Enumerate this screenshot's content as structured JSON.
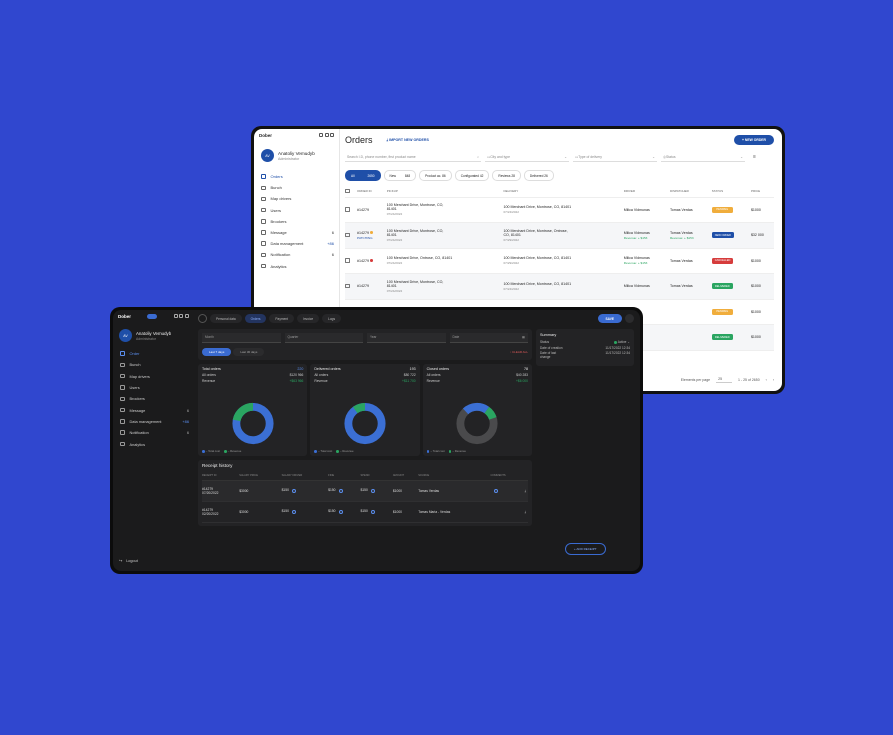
{
  "light": {
    "brand": "Dober",
    "user": {
      "initials": "AV",
      "name": "Anatoliy Vemudyb",
      "role": "Administrator"
    },
    "nav": [
      {
        "label": "Orders",
        "count": ""
      },
      {
        "label": "Bunch",
        "count": ""
      },
      {
        "label": "Map drivers",
        "count": ""
      },
      {
        "label": "Users",
        "count": ""
      },
      {
        "label": "Brookers",
        "count": ""
      },
      {
        "label": "Message",
        "count": "6"
      },
      {
        "label": "Data management",
        "count": "+86"
      },
      {
        "label": "Notification",
        "count": "6"
      },
      {
        "label": "Analytics",
        "count": ""
      }
    ],
    "title": "Orders",
    "import_label": "IMPORT NEW ORDERS",
    "new_order_label": "+ NEW ORDER",
    "search_placeholder": "Search I.D, phone number, first product name",
    "filter_city": "City and type",
    "filter_delivery": "Type of delivery",
    "filter_status": "Status",
    "tabs": [
      {
        "label": "All",
        "count": "2650"
      },
      {
        "label": "New",
        "count": "848"
      },
      {
        "label": "Product ac.",
        "count": "86"
      },
      {
        "label": "Configurated",
        "count": "42"
      },
      {
        "label": "Reviews",
        "count": "28"
      },
      {
        "label": "Delivered",
        "count": "26"
      }
    ],
    "columns": [
      "ORDER ID",
      "PICKUP",
      "DELIVERY",
      "DRIVER",
      "DISPATCHER",
      "STATUS",
      "PRICE"
    ],
    "rows": [
      {
        "id": "#14279",
        "flag": "",
        "flag_color": "",
        "pickup": "100 Merchant Drive, Montrose, CO, 81401",
        "pickup_date": "07/24/2022",
        "delivery": "100 Merchant Drive, Montrose, CO, 81401",
        "delivery_date": "07/24/2022",
        "driver": "Milica Vidmunas",
        "driver_sub": "",
        "dispatcher": "Tomas Verdas",
        "dispatcher_sub": "",
        "status": "PENDING",
        "status_color": "#f0ad3c",
        "price": "$1000"
      },
      {
        "id": "#14279",
        "flag": "PATCHING",
        "flag_color": "#f0ad3c",
        "pickup": "100 Merchant Drive, Montrose, CO, 81401",
        "pickup_date": "07/24/2022",
        "delivery": "100 Merchant Drive, Montrose, Ontrose, CO, 81401",
        "delivery_date": "07/29/2022",
        "driver": "Milica Vidmunas",
        "driver_sub": "Revenue: + $153",
        "dispatcher": "Tomas Verdas",
        "dispatcher_sub": "Revenue: + $153",
        "status": "NEW ORDER",
        "status_color": "#1f4fa8",
        "price": "$32 000"
      },
      {
        "id": "#14279",
        "flag": "",
        "flag_color": "#d63c3c",
        "pickup": "100 Merchant Drive, Ontrose, CO, 81401",
        "pickup_date": "07/24/2022",
        "delivery": "100 Merchant Drive, Montrose, CO, 81401",
        "delivery_date": "07/29/2022",
        "driver": "Milica Vidmunas",
        "driver_sub": "Revenue: + $153",
        "dispatcher": "Tomas Verdas",
        "dispatcher_sub": "",
        "status": "CANCELLED",
        "status_color": "#d63c3c",
        "price": "$1000"
      },
      {
        "id": "#14279",
        "flag": "",
        "flag_color": "",
        "pickup": "100 Merchant Drive, Montrose, CO, 81401",
        "pickup_date": "07/24/2022",
        "delivery": "100 Merchant Drive, Montrose, CO, 81401",
        "delivery_date": "07/24/2022",
        "driver": "Milica Vidmunas",
        "driver_sub": "",
        "dispatcher": "Tomas Verdas",
        "dispatcher_sub": "",
        "status": "DELIVERED",
        "status_color": "#2aa561",
        "price": "$1000"
      }
    ],
    "extra_rows": [
      {
        "status": "PENDING",
        "status_color": "#f0ad3c",
        "price": "$1000"
      },
      {
        "status": "DELIVERED",
        "status_color": "#2aa561",
        "price": "$1000"
      }
    ],
    "footer": {
      "per_page_label": "Elements per page",
      "per_page": "25",
      "range": "1 - 25 of 2650"
    }
  },
  "dark": {
    "brand": "Dober",
    "user": {
      "initials": "AV",
      "name": "Anatoliy Vemudyb",
      "role": "Administrator"
    },
    "nav": [
      {
        "label": "Order",
        "count": ""
      },
      {
        "label": "Bunch",
        "count": ""
      },
      {
        "label": "Map drivers",
        "count": ""
      },
      {
        "label": "Users",
        "count": ""
      },
      {
        "label": "Brockers",
        "count": ""
      },
      {
        "label": "Message",
        "count": "6"
      },
      {
        "label": "Data management",
        "count": "+86"
      },
      {
        "label": "Notification",
        "count": "6"
      },
      {
        "label": "Analytics",
        "count": ""
      }
    ],
    "logout": "Logout",
    "tabs": [
      "Personal data",
      "Orders",
      "Payment",
      "Invoice",
      "Logs"
    ],
    "save_label": "SAVE",
    "filters": [
      "Month",
      "Quarter",
      "Year",
      "Date"
    ],
    "periods": [
      "Last 7 days",
      "Last 30 days"
    ],
    "clear_label": "CLEAR ALL",
    "stats": [
      {
        "title": "Total orders",
        "value": "220",
        "value_blue": true,
        "all_label": "All orders",
        "all_value": "$120 966",
        "rev_label": "Revenue",
        "rev_value": "+$63 966",
        "share": 0.22
      },
      {
        "title": "Delivered orders",
        "value": "193",
        "value_blue": false,
        "all_label": "All orders",
        "all_value": "$80 722",
        "rev_label": "Revenue",
        "rev_value": "+$11 700",
        "share": 0.1
      },
      {
        "title": "Closed orders",
        "value": "78",
        "value_blue": false,
        "all_label": "All orders",
        "all_value": "$40 283",
        "rev_label": "Revenue",
        "rev_value": "+$6 000",
        "share": 0.1,
        "blue_share": 0.22
      }
    ],
    "legend": {
      "total": "Total cost",
      "revenue": "Revenue"
    },
    "summary": {
      "title": "Summary",
      "rows": [
        {
          "label": "Status",
          "value": "Active"
        },
        {
          "label": "Date of creation",
          "value": "11/17/2022 12:34"
        },
        {
          "label": "Date of last change",
          "value": "11/17/2022 12:34"
        }
      ]
    },
    "receipt": {
      "title": "Receipt history",
      "columns": [
        "RECEIPT ID",
        "SALARY PRICE",
        "SALARY DRIVER",
        "FINE",
        "SPEND",
        "AMOUNT",
        "SOURCE",
        "COMMENTS",
        ""
      ],
      "rows": [
        {
          "id": "#14279",
          "date": "07/20/2022",
          "salary_price": "$3000",
          "salary_driver": "$150",
          "fine": "$150",
          "spend": "$150",
          "amount": "$1000",
          "source": "Tomas Verdas"
        },
        {
          "id": "#14279",
          "date": "02/20/2022",
          "salary_price": "$3000",
          "salary_driver": "$150",
          "fine": "$150",
          "spend": "$150",
          "amount": "$1000",
          "source": "Tomas Maria - Verdas"
        }
      ]
    },
    "add_receipt_label": "+ ADD RECEIPT"
  },
  "colors": {
    "accent": "#3a6bd1",
    "donut_blue": "#3b6fd4",
    "donut_green": "#2aa561",
    "donut_gray": "#4a4a4c"
  }
}
